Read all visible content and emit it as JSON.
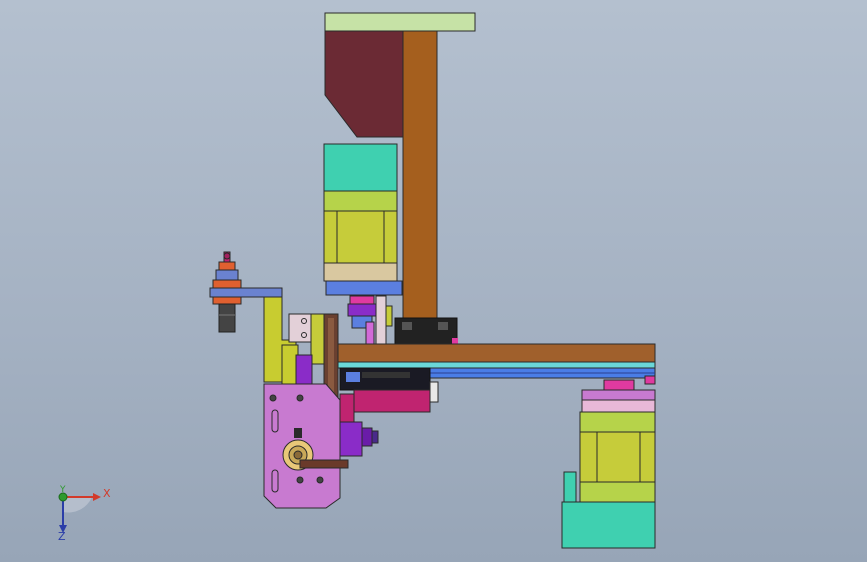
{
  "viewport": {
    "background_top": "#b4c0cf",
    "background_bottom": "#97a5b7"
  },
  "triad": {
    "x_label": "X",
    "y_label": "Y",
    "z_label": "Z",
    "x_color": "#d23a2a",
    "y_color": "#2e9a2e",
    "z_color": "#2b3ea8"
  },
  "parts": {
    "top_plate": "#c6e2a6",
    "back_block": "#6b2a34",
    "vertical_column": "#a55f1e",
    "stepper_motor_cap": "#3fd0b0",
    "stepper_motor_body": "#c6cc3a",
    "stepper_motor_ring": "#b6d34a",
    "motor_base": "#d9c8a0",
    "flange": "#5b7fe0",
    "coupling": "#e03aa0",
    "horizontal_beam": "#a0602c",
    "linear_rail": "#4a7de6",
    "carriage_block": "#c02470",
    "bracket_arm": "#6a82d0",
    "bracket_post": "#c8cc30",
    "gripper_body": "#c87ad0",
    "bearing_housing": "#e8c878",
    "cylinder": "#8a2cc8",
    "guide_plate": "#e3d0d8",
    "rail_cover": "#6ad8d8"
  }
}
